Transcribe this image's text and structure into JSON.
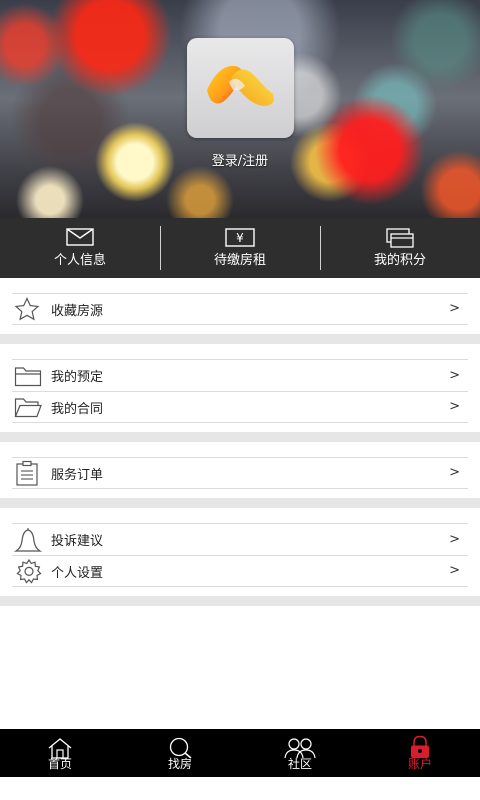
{
  "header": {
    "login_label": "登录/注册",
    "logo_colors": [
      "#f6c21a",
      "#ff8a1c",
      "#e8321e"
    ]
  },
  "quick_actions": [
    {
      "label": "个人信息",
      "icon": "envelope-icon"
    },
    {
      "label": "待缴房租",
      "icon": "yen-bill-icon"
    },
    {
      "label": "我的积分",
      "icon": "cards-icon"
    }
  ],
  "menu": {
    "favorites": {
      "label": "收藏房源",
      "icon": "star-icon",
      "chevron": ">"
    },
    "reservations": {
      "label": "我的预定",
      "icon": "folder-icon",
      "chevron": ">"
    },
    "contracts": {
      "label": "我的合同",
      "icon": "open-folder-icon",
      "chevron": ">"
    },
    "service_orders": {
      "label": "服务订单",
      "icon": "clipboard-icon",
      "chevron": ">"
    },
    "complaints": {
      "label": "投诉建议",
      "icon": "bell-icon",
      "chevron": ">"
    },
    "settings": {
      "label": "个人设置",
      "icon": "gear-icon",
      "chevron": ">"
    }
  },
  "tabbar": {
    "tabs": [
      {
        "label": "首页",
        "icon": "home-icon",
        "active": false
      },
      {
        "label": "找房",
        "icon": "search-icon",
        "active": false
      },
      {
        "label": "社区",
        "icon": "people-icon",
        "active": false
      },
      {
        "label": "账户",
        "icon": "lock-icon",
        "active": true
      }
    ],
    "active_color": "#d81e2c"
  }
}
